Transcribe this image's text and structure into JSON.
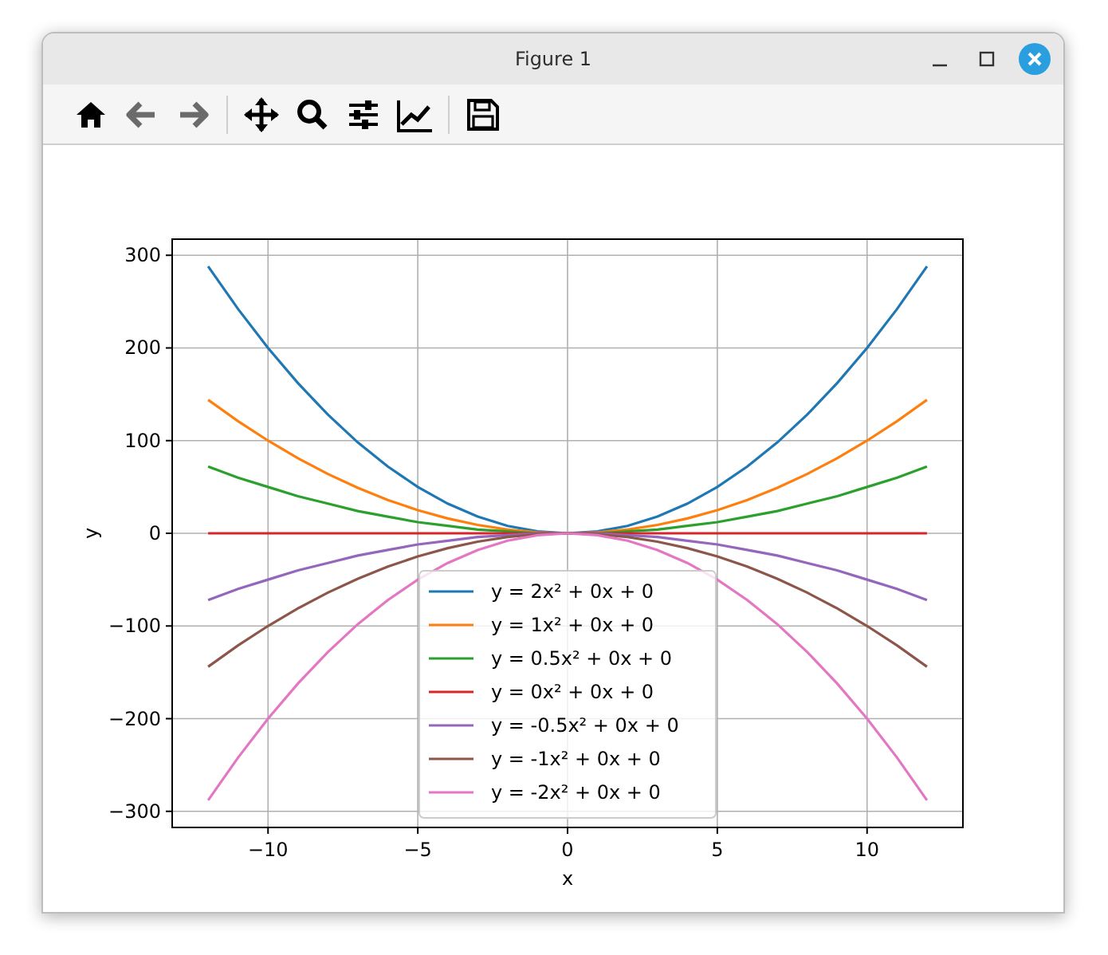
{
  "window": {
    "title": "Figure 1"
  },
  "toolbar": [
    {
      "kind": "home",
      "disabled": false
    },
    {
      "kind": "back",
      "disabled": true
    },
    {
      "kind": "forward",
      "disabled": true
    },
    {
      "kind": "separator"
    },
    {
      "kind": "pan",
      "disabled": false
    },
    {
      "kind": "zoom",
      "disabled": false
    },
    {
      "kind": "subplots",
      "disabled": false
    },
    {
      "kind": "axes",
      "disabled": false
    },
    {
      "kind": "separator"
    },
    {
      "kind": "save",
      "disabled": false
    }
  ],
  "chart_data": {
    "type": "line",
    "xlabel": "x",
    "ylabel": "y",
    "x": [
      -12,
      -11,
      -10,
      -9,
      -8,
      -7,
      -6,
      -5,
      -4,
      -3,
      -2,
      -1,
      0,
      1,
      2,
      3,
      4,
      5,
      6,
      7,
      8,
      9,
      10,
      11,
      12
    ],
    "series": [
      {
        "name": "y = 2x² + 0x + 0",
        "color": "#1f77b4",
        "values": [
          288,
          242,
          200,
          162,
          128,
          98,
          72,
          50,
          32,
          18,
          8,
          2,
          0,
          2,
          8,
          18,
          32,
          50,
          72,
          98,
          128,
          162,
          200,
          242,
          288
        ]
      },
      {
        "name": "y = 1x² + 0x + 0",
        "color": "#ff7f0e",
        "values": [
          144,
          121,
          100,
          81,
          64,
          49,
          36,
          25,
          16,
          9,
          4,
          1,
          0,
          1,
          4,
          9,
          16,
          25,
          36,
          49,
          64,
          81,
          100,
          121,
          144
        ]
      },
      {
        "name": "y = 0.5x² + 0x + 0",
        "color": "#2ca02c",
        "values": [
          72,
          60,
          50,
          40,
          32,
          24,
          18,
          12,
          8,
          4,
          2,
          0,
          0,
          0,
          2,
          4,
          8,
          12,
          18,
          24,
          32,
          40,
          50,
          60,
          72
        ]
      },
      {
        "name": "y = 0x² + 0x + 0",
        "color": "#d62728",
        "values": [
          0,
          0,
          0,
          0,
          0,
          0,
          0,
          0,
          0,
          0,
          0,
          0,
          0,
          0,
          0,
          0,
          0,
          0,
          0,
          0,
          0,
          0,
          0,
          0,
          0
        ]
      },
      {
        "name": "y = -0.5x² + 0x + 0",
        "color": "#9467bd",
        "values": [
          -72,
          -60,
          -50,
          -40,
          -32,
          -24,
          -18,
          -12,
          -8,
          -4,
          -2,
          0,
          0,
          0,
          -2,
          -4,
          -8,
          -12,
          -18,
          -24,
          -32,
          -40,
          -50,
          -60,
          -72
        ]
      },
      {
        "name": "y = -1x² + 0x + 0",
        "color": "#8c564b",
        "values": [
          -144,
          -121,
          -100,
          -81,
          -64,
          -49,
          -36,
          -25,
          -16,
          -9,
          -4,
          -1,
          0,
          -1,
          -4,
          -9,
          -16,
          -25,
          -36,
          -49,
          -64,
          -81,
          -100,
          -121,
          -144
        ]
      },
      {
        "name": "y = -2x² + 0x + 0",
        "color": "#e377c2",
        "values": [
          -288,
          -242,
          -200,
          -162,
          -128,
          -98,
          -72,
          -50,
          -32,
          -18,
          -8,
          -2,
          0,
          -2,
          -8,
          -18,
          -32,
          -50,
          -72,
          -98,
          -128,
          -162,
          -200,
          -242,
          -288
        ]
      }
    ],
    "grid": true,
    "legend": true,
    "xlim": [
      -13.2,
      13.2
    ],
    "ylim": [
      -317.4,
      317.4
    ],
    "xticks": [
      {
        "value": -10,
        "label": "−10"
      },
      {
        "value": -5,
        "label": "−5"
      },
      {
        "value": 0,
        "label": "0"
      },
      {
        "value": 5,
        "label": "5"
      },
      {
        "value": 10,
        "label": "10"
      }
    ],
    "yticks": [
      {
        "value": -300,
        "label": "−300"
      },
      {
        "value": -200,
        "label": "−200"
      },
      {
        "value": -100,
        "label": "−100"
      },
      {
        "value": 0,
        "label": "0"
      },
      {
        "value": 100,
        "label": "100"
      },
      {
        "value": 200,
        "label": "200"
      },
      {
        "value": 300,
        "label": "300"
      }
    ]
  }
}
